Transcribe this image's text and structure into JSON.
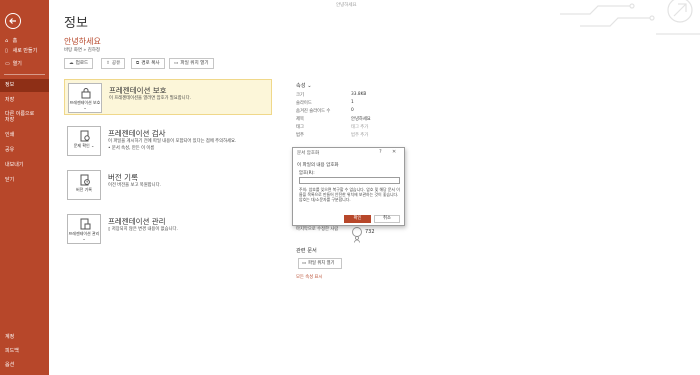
{
  "titlebar": {
    "title": "안녕하세요"
  },
  "sidebar": {
    "items": [
      {
        "label": "홈",
        "icon": "home-icon"
      },
      {
        "label": "새로 만들기",
        "icon": "new-file-icon"
      },
      {
        "label": "열기",
        "icon": "folder-open-icon"
      },
      {
        "label": "정보"
      },
      {
        "label": "저장"
      },
      {
        "label": "다른 이름으로 저장"
      },
      {
        "label": "인쇄"
      },
      {
        "label": "공유"
      },
      {
        "label": "내보내기"
      },
      {
        "label": "닫기"
      },
      {
        "label": "계정"
      },
      {
        "label": "피드백"
      },
      {
        "label": "옵션"
      }
    ]
  },
  "main": {
    "page_title": "정보",
    "doc_name": "안녕하세요",
    "doc_path": "바탕 화면 » 김하정",
    "actions": [
      {
        "label": "업로드",
        "icon": "upload-icon"
      },
      {
        "label": "공유",
        "icon": "share-icon"
      },
      {
        "label": "경로 복사",
        "icon": "copy-path-icon"
      },
      {
        "label": "파일 위치 열기",
        "icon": "folder-icon"
      }
    ],
    "cards": [
      {
        "icon_label": "프레젠테이션 보호 ⌄",
        "title": "프레젠테이션 보호",
        "desc": "이 프레젠테이션을 열려면 암호가 필요합니다."
      },
      {
        "icon_label": "문제 확인 ⌄",
        "title": "프레젠테이션 검사",
        "desc": "이 파일을 게시하기 전에 파일 내용이 포함되어 있다는 점에 주의하세요.",
        "bullet": "문서 속성, 만든 이 이름"
      },
      {
        "icon_label": "버전 기록",
        "title": "버전 기록",
        "desc": "이전 버전을 보고 복원합니다."
      },
      {
        "icon_label": "프레젠테이션 관리 ⌄",
        "title": "프레젠테이션 관리",
        "desc": "저장되지 않은 변경 내용이 없습니다."
      }
    ]
  },
  "properties": {
    "heading": "속성 ⌄",
    "rows": [
      {
        "key": "크기",
        "value": "33.8KB"
      },
      {
        "key": "슬라이드",
        "value": "1"
      },
      {
        "key": "숨겨진 슬라이드 수",
        "value": "0"
      },
      {
        "key": "제목",
        "value": "안녕하세요"
      },
      {
        "key": "태그",
        "value": "태그 추가"
      },
      {
        "key": "범주",
        "value": "범주 추가"
      }
    ],
    "last_modified_label": "마지막으로 수정한 사람",
    "last_modified_by": "732"
  },
  "related": {
    "heading": "관련 문서",
    "open_location": "파일 위치 열기",
    "all_props_link": "모든 속성 표시"
  },
  "dialog": {
    "title": "문서 암호화",
    "help": "?",
    "close": "✕",
    "message": "이 파일의 내용 암호화",
    "label": "암호(R):",
    "password_value": "",
    "warning": "주의: 암호를 잊으면 복구할 수 없습니다. 암호 및 해당 문서 이름을 목록으로 만들어 안전한 위치에 보관하는 것이 좋습니다. 암호는 대/소문자를 구분합니다.",
    "ok": "확인",
    "cancel": "취소"
  },
  "colors": {
    "accent": "#b7472a",
    "highlight_card": "#fcf6d9"
  }
}
